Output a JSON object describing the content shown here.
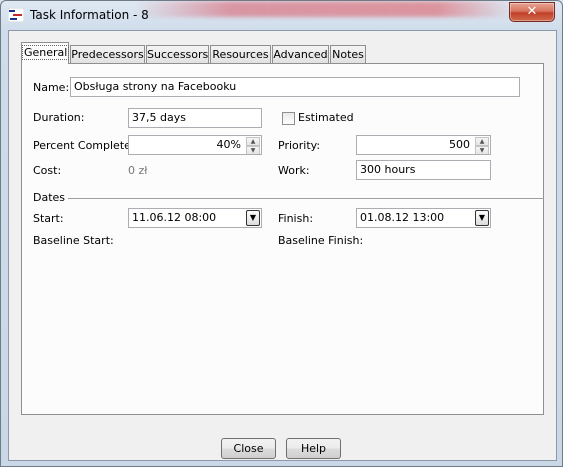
{
  "window": {
    "title": "Task Information - 8",
    "close_glyph": "✕"
  },
  "tabs": [
    {
      "label": "General",
      "active": true
    },
    {
      "label": "Predecessors"
    },
    {
      "label": "Successors"
    },
    {
      "label": "Resources"
    },
    {
      "label": "Advanced"
    },
    {
      "label": "Notes"
    }
  ],
  "general": {
    "name_label": "Name:",
    "name_value": "Obsługa strony na Facebooku",
    "duration_label": "Duration:",
    "duration_value": "37,5 days",
    "estimated_label": "Estimated",
    "estimated_checked": false,
    "percent_label": "Percent Complete:",
    "percent_value": "40%",
    "priority_label": "Priority:",
    "priority_value": "500",
    "cost_label": "Cost:",
    "cost_value": "0 zł",
    "work_label": "Work:",
    "work_value": "300 hours",
    "dates_heading": "Dates",
    "start_label": "Start:",
    "start_value": "11.06.12 08:00",
    "finish_label": "Finish:",
    "finish_value": "01.08.12 13:00",
    "baseline_start_label": "Baseline Start:",
    "baseline_finish_label": "Baseline Finish:"
  },
  "buttons": {
    "close": "Close",
    "help": "Help"
  },
  "icons": {
    "spin_up": "▲",
    "spin_down": "▼",
    "dropdown": "▼"
  }
}
